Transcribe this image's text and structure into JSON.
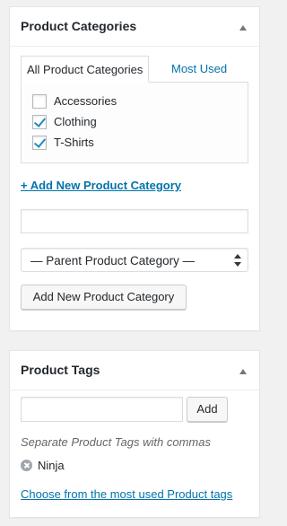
{
  "categories_box": {
    "title": "Product Categories",
    "tabs": [
      {
        "label": "All Product Categories"
      },
      {
        "label": "Most Used"
      }
    ],
    "items": [
      {
        "label": "Accessories",
        "checked": false
      },
      {
        "label": "Clothing",
        "checked": true
      },
      {
        "label": "T-Shirts",
        "checked": true
      }
    ],
    "add_new_link": "+ Add New Product Category",
    "new_category_value": "",
    "parent_select_value": "— Parent Product Category —",
    "add_button": "Add New Product Category"
  },
  "tags_box": {
    "title": "Product Tags",
    "tag_input_value": "",
    "add_button": "Add",
    "help_text": "Separate Product Tags with commas",
    "tags": [
      {
        "label": "Ninja",
        "remove_icon": "remove-circle-icon"
      }
    ],
    "choose_link": "Choose from the most used Product tags"
  },
  "colors": {
    "link": "#0073aa",
    "checkmark": "#1e8cbe",
    "background": "#f1f1f1"
  }
}
